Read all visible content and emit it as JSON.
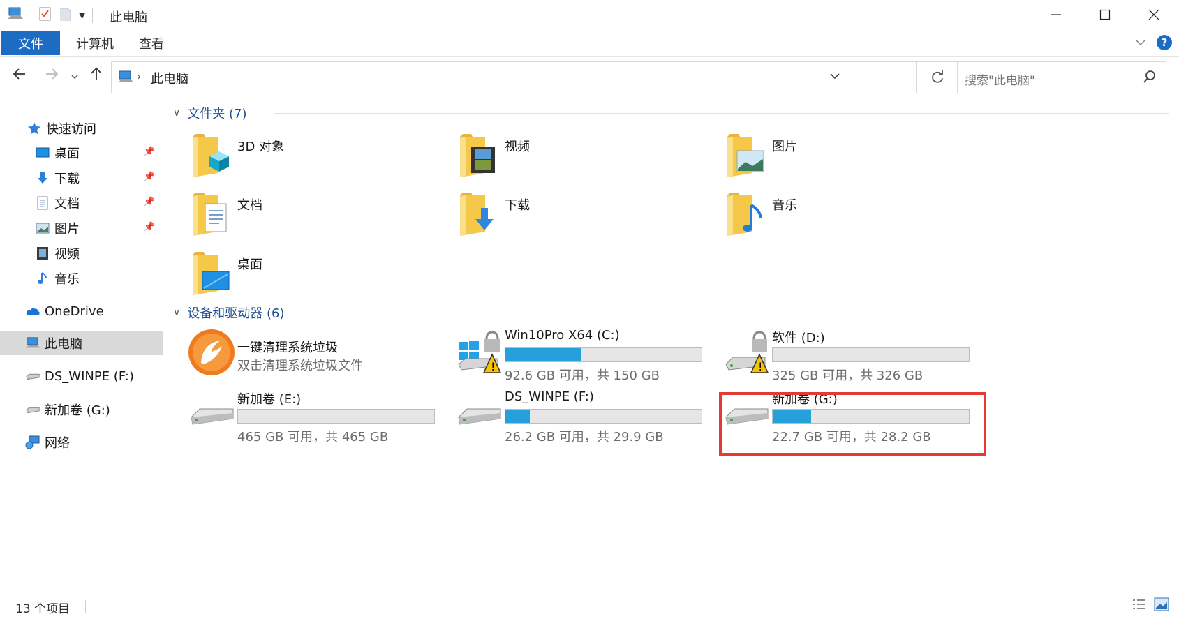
{
  "window": {
    "title": "此电脑",
    "minimize": "—",
    "maximize": "☐",
    "close": "✕"
  },
  "ribbon": {
    "tabs": [
      {
        "label": "文件"
      },
      {
        "label": "计算机"
      },
      {
        "label": "查看"
      }
    ]
  },
  "address": {
    "path": "此电脑",
    "search_placeholder": "搜索\"此电脑\""
  },
  "sidebar": {
    "items": [
      {
        "label": "快速访问",
        "icon": "star-icon"
      },
      {
        "label": "桌面",
        "icon": "desktop-icon",
        "pinned": true
      },
      {
        "label": "下载",
        "icon": "download-icon",
        "pinned": true
      },
      {
        "label": "文档",
        "icon": "document-icon",
        "pinned": true
      },
      {
        "label": "图片",
        "icon": "picture-icon",
        "pinned": true
      },
      {
        "label": "视频",
        "icon": "video-icon"
      },
      {
        "label": "音乐",
        "icon": "music-icon"
      },
      {
        "label": "OneDrive",
        "icon": "cloud-icon"
      },
      {
        "label": "此电脑",
        "icon": "computer-icon",
        "selected": true
      },
      {
        "label": "DS_WINPE (F:)",
        "icon": "drive-icon"
      },
      {
        "label": "新加卷 (G:)",
        "icon": "drive-icon"
      },
      {
        "label": "网络",
        "icon": "network-icon"
      }
    ]
  },
  "folders_group": {
    "header": "文件夹 (7)",
    "items": [
      {
        "name": "3D 对象",
        "icon": "3d-objects-icon"
      },
      {
        "name": "视频",
        "icon": "video-folder-icon"
      },
      {
        "name": "图片",
        "icon": "pictures-folder-icon"
      },
      {
        "name": "文档",
        "icon": "documents-folder-icon"
      },
      {
        "name": "下载",
        "icon": "downloads-folder-icon"
      },
      {
        "name": "音乐",
        "icon": "music-folder-icon"
      },
      {
        "name": "桌面",
        "icon": "desktop-folder-icon"
      }
    ]
  },
  "drives_group": {
    "header": "设备和驱动器 (6)",
    "app": {
      "name": "一键清理系统垃圾",
      "subtitle": "双击清理系统垃圾文件"
    },
    "drives": [
      {
        "name": "Win10Pro X64 (C:)",
        "info": "92.6 GB 可用，共 150 GB",
        "used_fraction": 0.383,
        "icon": "system-drive-warning-icon"
      },
      {
        "name": "软件 (D:)",
        "info": "325 GB 可用，共 326 GB",
        "used_fraction": 0.003,
        "icon": "drive-warning-icon"
      },
      {
        "name": "新加卷 (E:)",
        "info": "465 GB 可用，共 465 GB",
        "used_fraction": 0.0,
        "icon": "drive-icon"
      },
      {
        "name": "DS_WINPE (F:)",
        "info": "26.2 GB 可用，共 29.9 GB",
        "used_fraction": 0.124,
        "icon": "drive-icon"
      },
      {
        "name": "新加卷 (G:)",
        "info": "22.7 GB 可用，共 28.2 GB",
        "used_fraction": 0.195,
        "icon": "drive-icon",
        "highlighted": true
      }
    ]
  },
  "status": {
    "count": "13 个项目"
  },
  "colors": {
    "accent": "#1c6cc4",
    "bar_fill": "#26a0da",
    "highlight": "#e53935",
    "folder": "#f5c542"
  }
}
